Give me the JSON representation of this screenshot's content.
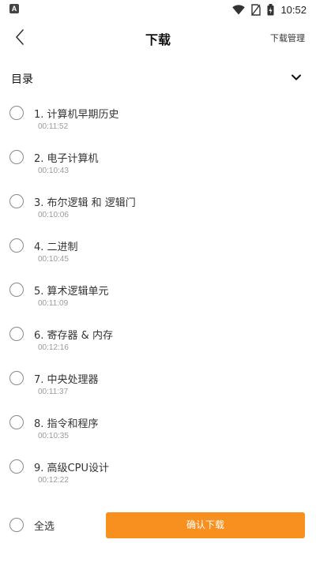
{
  "status_bar": {
    "left_icon": "A",
    "time": "10:52",
    "icons": [
      "wifi-icon",
      "no-sim-icon",
      "battery-icon"
    ]
  },
  "header": {
    "back_icon": "chevron-left-icon",
    "title": "下载",
    "manage_label": "下载管理"
  },
  "catalog": {
    "title": "目录",
    "chevron_icon": "chevron-down-icon"
  },
  "items": [
    {
      "title": "1. 计算机早期历史",
      "duration": "00:11:52"
    },
    {
      "title": "2. 电子计算机",
      "duration": "00:10:43"
    },
    {
      "title": "3. 布尔逻辑 和 逻辑门",
      "duration": "00:10:06"
    },
    {
      "title": "4. 二进制",
      "duration": "00:10:45"
    },
    {
      "title": "5. 算术逻辑单元",
      "duration": "00:11:09"
    },
    {
      "title": "6. 寄存器 & 内存",
      "duration": "00:12:16"
    },
    {
      "title": "7. 中央处理器",
      "duration": "00:11:37"
    },
    {
      "title": "8. 指令和程序",
      "duration": "00:10:35"
    },
    {
      "title": "9. 高级CPU设计",
      "duration": "00:12:22"
    }
  ],
  "footer": {
    "select_all_label": "全选",
    "confirm_label": "确认下载"
  },
  "colors": {
    "accent": "#f7901e",
    "text": "#333333",
    "secondary_text": "#9a9a9a"
  }
}
